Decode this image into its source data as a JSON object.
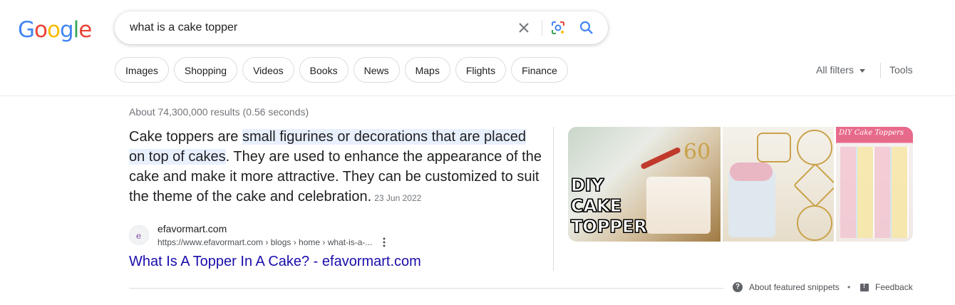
{
  "logo": {
    "letters": [
      "G",
      "o",
      "o",
      "g",
      "l",
      "e"
    ],
    "colors": [
      "#4285f4",
      "#ea4335",
      "#fbbc05",
      "#4285f4",
      "#34a853",
      "#ea4335"
    ]
  },
  "search": {
    "query": "what is a cake topper"
  },
  "icons": {
    "clear": "close-icon",
    "lens": "google-lens-icon",
    "search": "search-icon"
  },
  "chips": [
    "Images",
    "Shopping",
    "Videos",
    "Books",
    "News",
    "Maps",
    "Flights",
    "Finance"
  ],
  "filters": {
    "all_filters": "All filters",
    "tools": "Tools"
  },
  "result_stats": "About 74,300,000 results (0.56 seconds)",
  "snippet": {
    "pre": "Cake toppers are ",
    "highlight": "small figurines or decorations that are placed on top of cakes",
    "post": ". They are used to enhance the appearance of the cake and make it more attractive. They can be customized to suit the theme of the cake and celebration.",
    "date": "23 Jun 2022",
    "highlight_color": "#e8f0fe"
  },
  "source": {
    "site_name": "efavormart.com",
    "url": "https://www.efavormart.com › blogs › home › what-is-a-...",
    "link_title": "What Is A Topper In A Cake? - efavormart.com",
    "link_color": "#1a0dab"
  },
  "images": [
    {
      "caption": "DIY CAKE TOPPER"
    },
    {
      "caption": ""
    },
    {
      "caption": "DIY Cake Toppers"
    }
  ],
  "footer": {
    "about": "About featured snippets",
    "bullet": "•",
    "feedback": "Feedback"
  }
}
